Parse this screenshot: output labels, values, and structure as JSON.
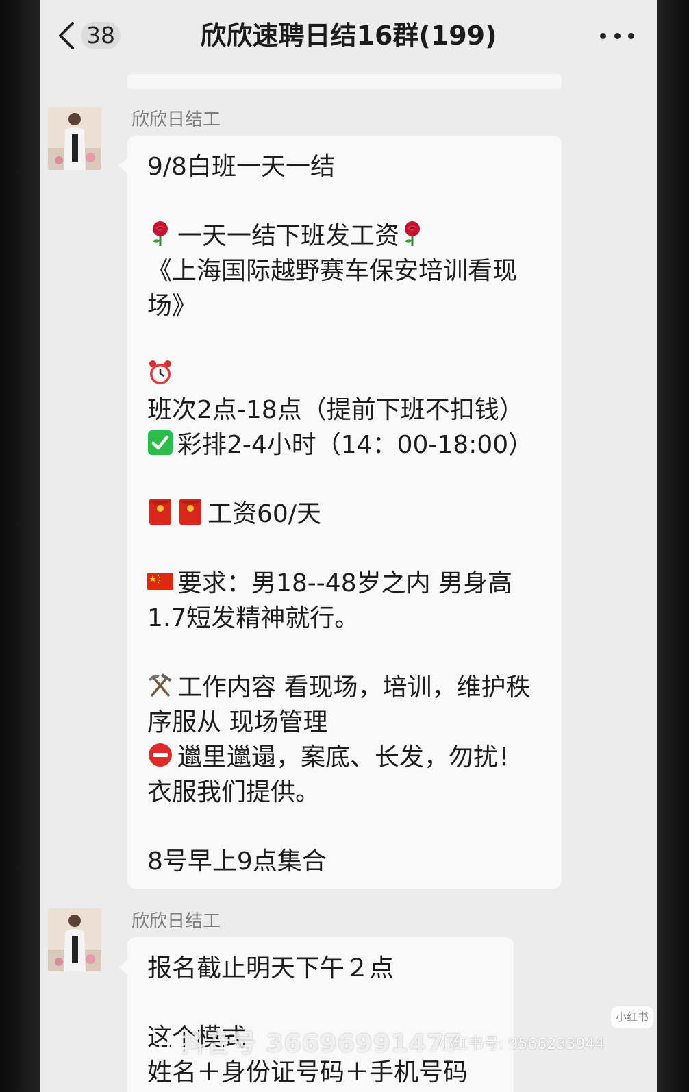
{
  "header": {
    "unread_count": "38",
    "title": "欣欣速聘日结16群(199)"
  },
  "messages": [
    {
      "sender": "欣欣日结工",
      "lines": [
        {
          "icon": "",
          "text": "9/8白班一天一结"
        },
        {
          "gap": true
        },
        {
          "icon": "rose-icon",
          "text": "一天一结下班发工资",
          "trail_icon": "rose-icon"
        },
        {
          "icon": "",
          "text": "《上海国际越野赛车保安培训看现场》"
        },
        {
          "gap": true
        },
        {
          "icon": "alarm-clock-icon",
          "text": "班次2点-18点（提前下班不扣钱）"
        },
        {
          "icon": "check-mark-icon",
          "text": "彩排2-4小时（14：00-18:00）"
        },
        {
          "gap": true
        },
        {
          "icon": "red-envelope-icon",
          "icon2": "red-envelope-icon",
          "text": "工资60/天"
        },
        {
          "gap": true
        },
        {
          "icon": "china-flag-icon",
          "text": "要求：男18--48岁之内  男身高1.7短发精神就行。"
        },
        {
          "gap": true
        },
        {
          "icon": "hammer-pick-icon",
          "text": "工作内容  看现场，培训，维护秩序服从 现场管理"
        },
        {
          "icon": "no-entry-icon",
          "text": "邋里邋遢，案底、长发，勿扰！衣服我们提供。"
        },
        {
          "gap": true
        },
        {
          "icon": "",
          "text": "8号早上9点集合"
        }
      ]
    },
    {
      "sender": "欣欣日结工",
      "lines": [
        {
          "icon": "",
          "text": "报名截止明天下午２点"
        },
        {
          "gap": true
        },
        {
          "icon": "",
          "text": "这个模式"
        },
        {
          "icon": "",
          "text": "姓名＋身份证号码＋手机号码"
        }
      ]
    }
  ],
  "watermark": {
    "main": "抖音号 36696991477",
    "sub": "小红书号: 9566233944",
    "badge": "小红书"
  },
  "colors": {
    "background": "#ececec",
    "bubble": "#f9f9f9",
    "sender": "#7d7d7d"
  }
}
